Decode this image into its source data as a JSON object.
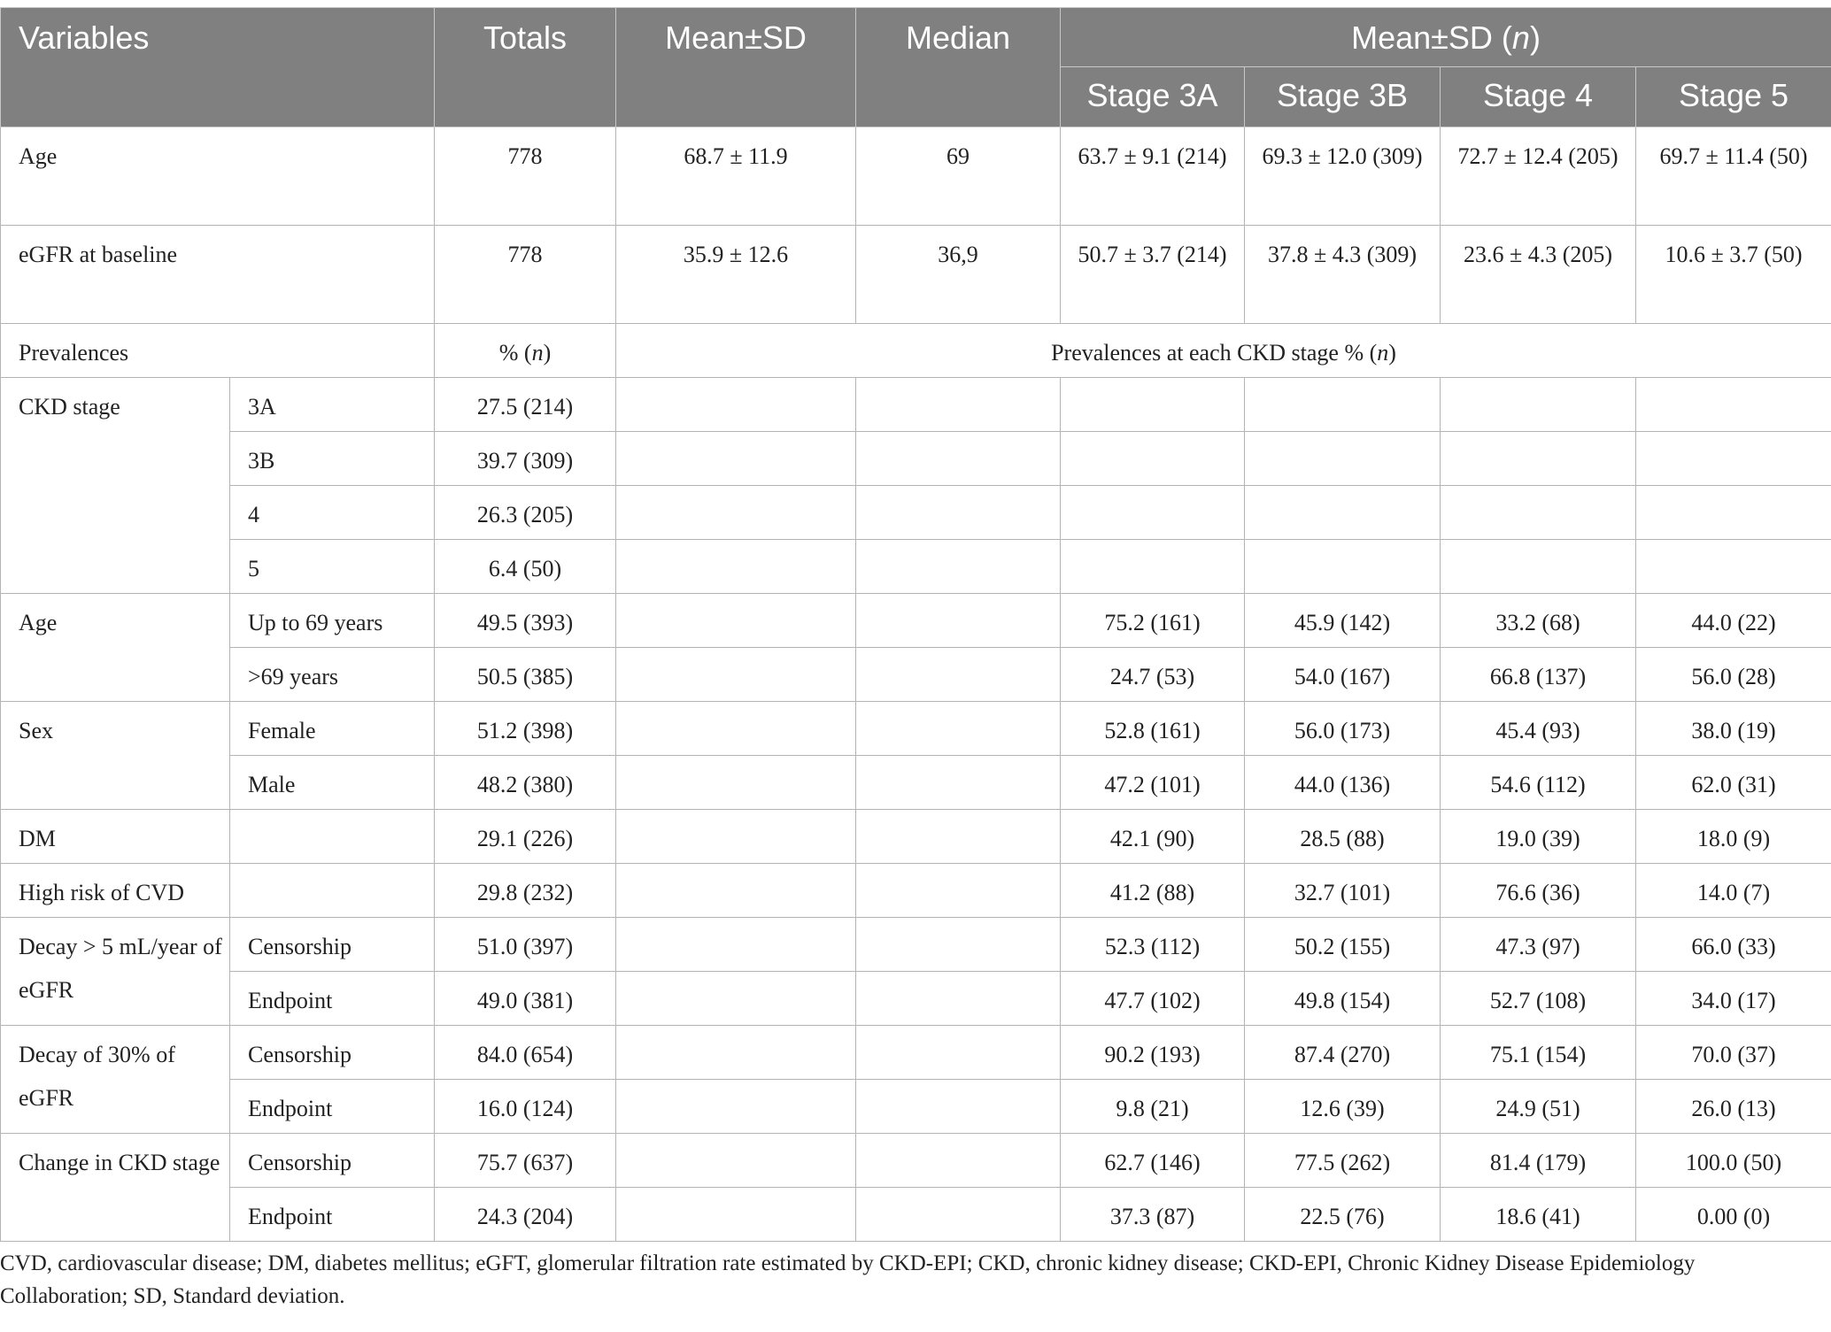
{
  "header": {
    "variables": "Variables",
    "totals": "Totals",
    "mean_sd": "Mean±SD",
    "median": "Median",
    "group_prefix": "Mean±SD (",
    "group_n": "n",
    "group_suffix": ")",
    "stages": [
      "Stage 3A",
      "Stage 3B",
      "Stage 4",
      "Stage 5"
    ]
  },
  "rows": {
    "age": {
      "label": "Age",
      "total": "778",
      "mean": "68.7 ± 11.9",
      "median": "69",
      "stages": [
        "63.7 ± 9.1 (214)",
        "69.3 ± 12.0 (309)",
        "72.7 ± 12.4 (205)",
        "69.7 ± 11.4 (50)"
      ]
    },
    "egfr": {
      "label": "eGFR at baseline",
      "total": "778",
      "mean": "35.9 ± 12.6",
      "median": "36,9",
      "stages": [
        "50.7 ± 3.7 (214)",
        "37.8 ± 4.3 (309)",
        "23.6 ± 4.3 (205)",
        "10.6 ± 3.7 (50)"
      ]
    },
    "prevalences": {
      "label": "Prevalences",
      "total_prefix": "% (",
      "total_n": "n",
      "total_suffix": ")",
      "span_prefix": "Prevalences at each CKD stage % (",
      "span_n": "n",
      "span_suffix": ")"
    },
    "ckd_stage": {
      "label": "CKD stage",
      "items": [
        {
          "sub": "3A",
          "total": "27.5 (214)"
        },
        {
          "sub": "3B",
          "total": "39.7 (309)"
        },
        {
          "sub": "4",
          "total": "26.3 (205)"
        },
        {
          "sub": "5",
          "total": "6.4 (50)"
        }
      ]
    },
    "age_group": {
      "label": "Age",
      "items": [
        {
          "sub": "Up to 69 years",
          "total": "49.5 (393)",
          "stages": [
            "75.2 (161)",
            "45.9 (142)",
            "33.2 (68)",
            "44.0 (22)"
          ]
        },
        {
          "sub": ">69 years",
          "total": "50.5 (385)",
          "stages": [
            "24.7 (53)",
            "54.0 (167)",
            "66.8 (137)",
            "56.0 (28)"
          ]
        }
      ]
    },
    "sex": {
      "label": "Sex",
      "items": [
        {
          "sub": "Female",
          "total": "51.2 (398)",
          "stages": [
            "52.8 (161)",
            "56.0 (173)",
            "45.4 (93)",
            "38.0 (19)"
          ]
        },
        {
          "sub": "Male",
          "total": "48.2 (380)",
          "stages": [
            "47.2 (101)",
            "44.0 (136)",
            "54.6 (112)",
            "62.0 (31)"
          ]
        }
      ]
    },
    "dm": {
      "label": "DM",
      "total": "29.1 (226)",
      "stages": [
        "42.1 (90)",
        "28.5 (88)",
        "19.0 (39)",
        "18.0 (9)"
      ]
    },
    "cvd": {
      "label": "High risk of CVD",
      "total": "29.8 (232)",
      "stages": [
        "41.2 (88)",
        "32.7 (101)",
        "76.6 (36)",
        "14.0 (7)"
      ]
    },
    "decay5": {
      "label": "Decay > 5 mL/year of eGFR",
      "items": [
        {
          "sub": "Censorship",
          "total": "51.0 (397)",
          "stages": [
            "52.3 (112)",
            "50.2 (155)",
            "47.3 (97)",
            "66.0 (33)"
          ]
        },
        {
          "sub": "Endpoint",
          "total": "49.0 (381)",
          "stages": [
            "47.7 (102)",
            "49.8 (154)",
            "52.7 (108)",
            "34.0 (17)"
          ]
        }
      ]
    },
    "decay30": {
      "label": "Decay of 30% of eGFR",
      "items": [
        {
          "sub": "Censorship",
          "total": "84.0 (654)",
          "stages": [
            "90.2 (193)",
            "87.4 (270)",
            "75.1 (154)",
            "70.0 (37)"
          ]
        },
        {
          "sub": "Endpoint",
          "total": "16.0 (124)",
          "stages": [
            "9.8 (21)",
            "12.6 (39)",
            "24.9 (51)",
            "26.0 (13)"
          ]
        }
      ]
    },
    "change": {
      "label": "Change in CKD stage",
      "items": [
        {
          "sub": "Censorship",
          "total": "75.7 (637)",
          "stages": [
            "62.7 (146)",
            "77.5 (262)",
            "81.4 (179)",
            "100.0 (50)"
          ]
        },
        {
          "sub": "Endpoint",
          "total": "24.3 (204)",
          "stages": [
            "37.3 (87)",
            "22.5 (76)",
            "18.6 (41)",
            "0.00 (0)"
          ]
        }
      ]
    }
  },
  "footnote": "CVD, cardiovascular disease; DM, diabetes mellitus; eGFT, glomerular filtration rate estimated by CKD-EPI; CKD, chronic kidney disease; CKD-EPI, Chronic Kidney Disease Epidemiology Collaboration; SD, Standard deviation."
}
